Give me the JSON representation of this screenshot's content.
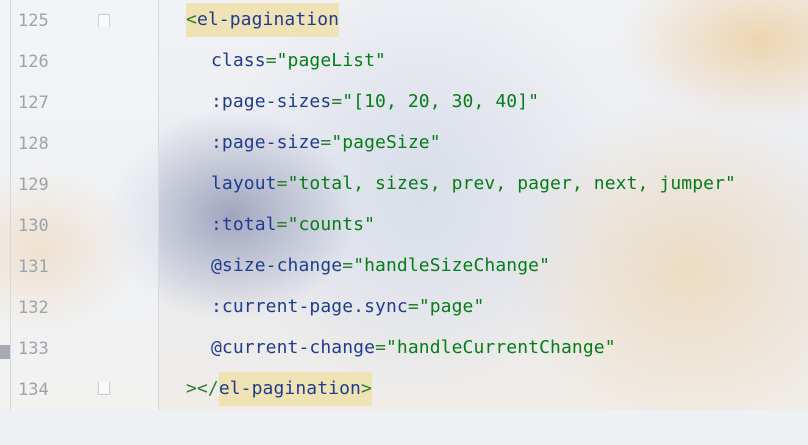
{
  "editor": {
    "lines": [
      {
        "number": "125",
        "open": "<",
        "tag": "el-pagination"
      },
      {
        "number": "126",
        "attr": "class",
        "eq": "=",
        "value": "\"pageList\""
      },
      {
        "number": "127",
        "attr": ":page-sizes",
        "eq": "=",
        "value": "\"[10, 20, 30, 40]\""
      },
      {
        "number": "128",
        "attr": ":page-size",
        "eq": "=",
        "value": "\"pageSize\""
      },
      {
        "number": "129",
        "attr": "layout",
        "eq": "=",
        "value": "\"total, sizes, prev, pager, next, jumper\""
      },
      {
        "number": "130",
        "attr": ":total",
        "eq": "=",
        "value": "\"counts\""
      },
      {
        "number": "131",
        "attr": "@size-change",
        "eq": "=",
        "value": "\"handleSizeChange\""
      },
      {
        "number": "132",
        "attr": ":current-page.sync",
        "eq": "=",
        "value": "\"page\""
      },
      {
        "number": "133",
        "attr": "@current-change",
        "eq": "=",
        "value": "\"handleCurrentChange\""
      },
      {
        "number": "134",
        "open": "></",
        "tag": "el-pagination",
        "close": ">"
      }
    ]
  },
  "colors": {
    "tag": "#1f3c8f",
    "attribute": "#1f3c8f",
    "string": "#067d17",
    "punctuation": "#2f7d32",
    "line_number": "#9ea3ab",
    "tag_highlight": "#efe3b5"
  },
  "icons": {
    "fold_start": "fold-open-icon",
    "fold_end": "fold-close-icon"
  }
}
